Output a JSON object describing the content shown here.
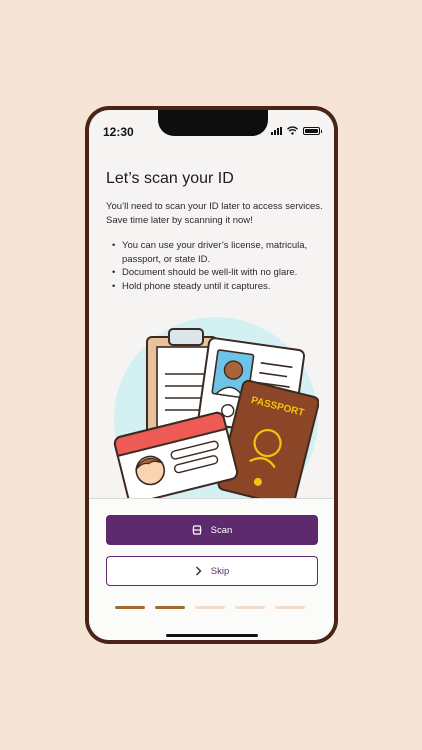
{
  "status_bar": {
    "time": "12:30"
  },
  "content": {
    "title": "Let’s scan your ID",
    "intro": "You’ll need to scan your ID later to access services. Save time later by scanning it now!",
    "bullets": [
      "You can use your driver’s license, matricula, passport, or state ID.",
      "Document should be well-lit with no glare.",
      "Hold phone steady until it captures."
    ]
  },
  "illustration": {
    "passport_text": "PASSPORT"
  },
  "actions": {
    "scan_label": "Scan",
    "skip_label": "Skip"
  },
  "progress": {
    "total_steps": 5,
    "completed_steps": 2
  },
  "colors": {
    "background": "#f6e5d6",
    "phone_frame": "#4a2416",
    "primary": "#5e2a6e",
    "progress_active": "#a06a33",
    "progress_inactive": "#f1ddd0",
    "passport": "#8a4626"
  }
}
